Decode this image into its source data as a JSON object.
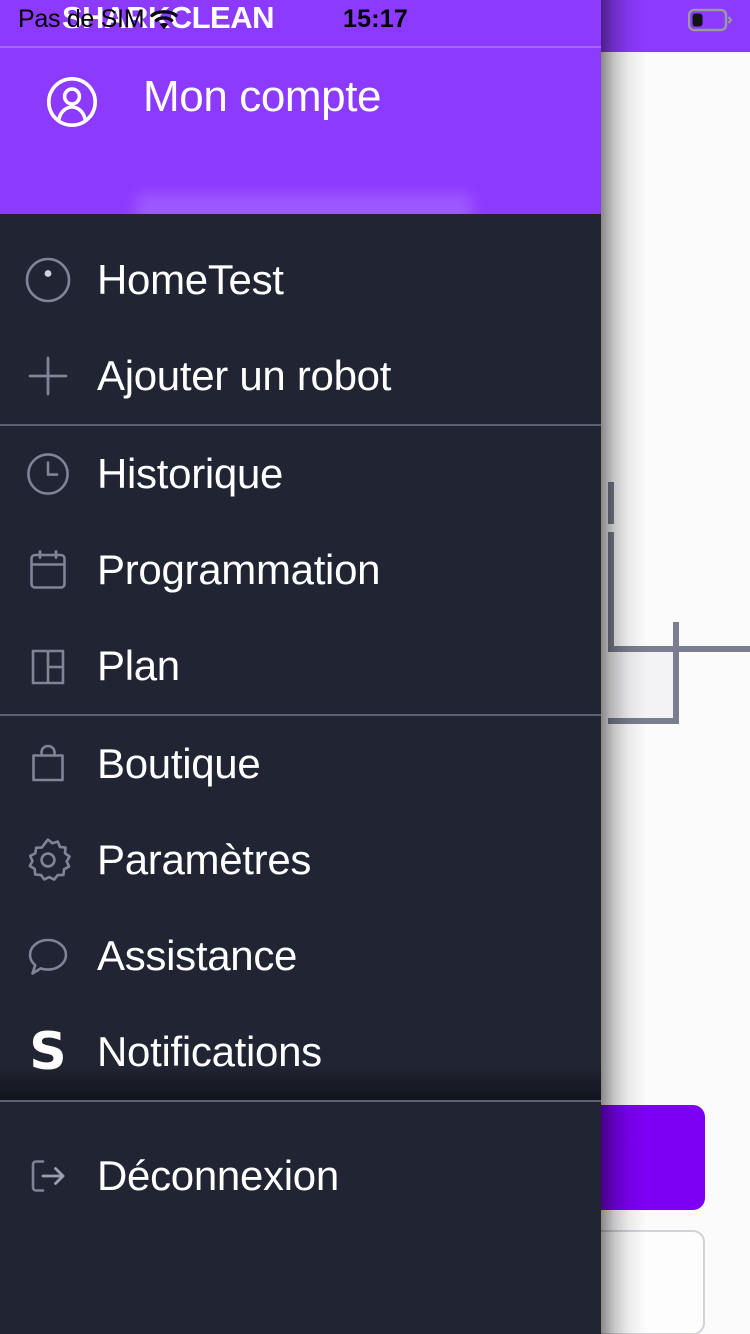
{
  "status_bar": {
    "carrier": "Pas de SIM",
    "time": "15:17",
    "wifi_icon": "wifi-icon",
    "battery_icon": "battery-low-icon",
    "battery_level_percent": 28
  },
  "brand": {
    "logo_text": "SHARKCLEAN",
    "accent_color": "#8C3AFF",
    "drawer_bg_color": "#212433",
    "cta_color": "#7D00F5"
  },
  "drawer": {
    "account": {
      "icon": "account-circle-icon",
      "title": "Mon compte",
      "email_redacted": true
    },
    "groups": [
      {
        "items": [
          {
            "icon": "robot-vacuum-icon",
            "label": "HomeTest"
          },
          {
            "icon": "plus-icon",
            "label": "Ajouter un robot"
          }
        ]
      },
      {
        "items": [
          {
            "icon": "clock-icon",
            "label": "Historique"
          },
          {
            "icon": "calendar-icon",
            "label": "Programmation"
          },
          {
            "icon": "floorplan-icon",
            "label": "Plan"
          }
        ]
      },
      {
        "items": [
          {
            "icon": "shopping-bag-icon",
            "label": "Boutique"
          },
          {
            "icon": "gear-icon",
            "label": "Paramètres"
          },
          {
            "icon": "chat-bubble-icon",
            "label": "Assistance"
          },
          {
            "icon": "shark-s-logo-icon",
            "label": "Notifications"
          }
        ]
      },
      {
        "items": [
          {
            "icon": "logout-icon",
            "label": "Déconnexion"
          }
        ]
      }
    ]
  },
  "background_app": {
    "map_outline": "floor-plan-outline",
    "primary_button": "",
    "secondary_button": ""
  }
}
